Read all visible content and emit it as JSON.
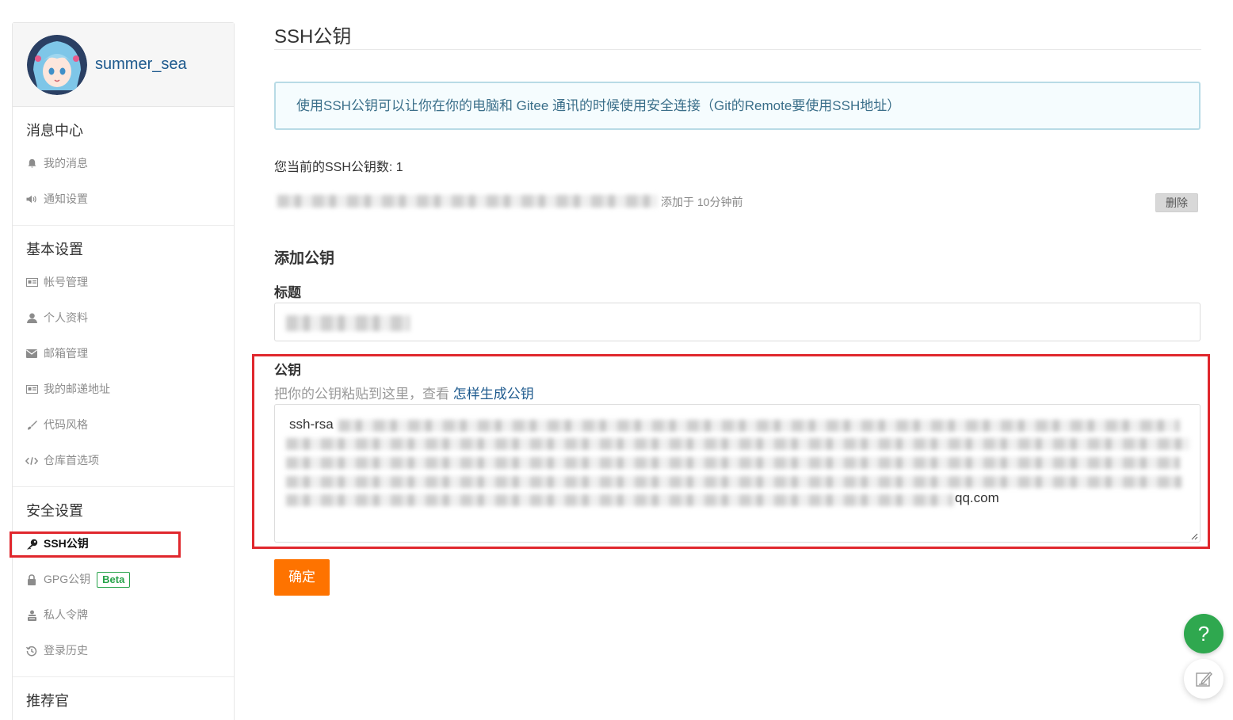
{
  "user": {
    "name": "summer_sea"
  },
  "sidebar": {
    "groups": [
      {
        "title": "消息中心",
        "items": [
          {
            "label": "我的消息",
            "icon": "bell-icon"
          },
          {
            "label": "通知设置",
            "icon": "speaker-icon"
          }
        ]
      },
      {
        "title": "基本设置",
        "items": [
          {
            "label": "帐号管理",
            "icon": "id-card-icon"
          },
          {
            "label": "个人资料",
            "icon": "user-icon"
          },
          {
            "label": "邮箱管理",
            "icon": "envelope-icon"
          },
          {
            "label": "我的邮递地址",
            "icon": "address-card-icon"
          },
          {
            "label": "代码风格",
            "icon": "brush-icon"
          },
          {
            "label": "仓库首选项",
            "icon": "code-icon"
          }
        ]
      },
      {
        "title": "安全设置",
        "items": [
          {
            "label": "SSH公钥",
            "icon": "key-icon",
            "active": true
          },
          {
            "label": "GPG公钥",
            "icon": "lock-icon",
            "badge": "Beta"
          },
          {
            "label": "私人令牌",
            "icon": "token-icon"
          },
          {
            "label": "登录历史",
            "icon": "history-icon"
          }
        ]
      },
      {
        "title": "推荐官",
        "items": []
      }
    ]
  },
  "main": {
    "title": "SSH公钥",
    "info": "使用SSH公钥可以让你在你的电脑和 Gitee 通讯的时候使用安全连接（Git的Remote要使用SSH地址）",
    "key_count": "您当前的SSH公钥数: 1",
    "key_added": "添加于 10分钟前",
    "delete_label": "删除",
    "add_heading": "添加公钥",
    "title_label": "标题",
    "pubkey_label": "公钥",
    "hint_prefix": "把你的公钥粘贴到这里，查看 ",
    "hint_link": "怎样生成公钥",
    "pubkey_prefix": "ssh-rsa ",
    "pubkey_suffix": "qq.com",
    "submit_label": "确定"
  },
  "floating": {
    "help": "?"
  },
  "colors": {
    "accent": "#fe7300",
    "link": "#1e5a8e",
    "highlight": "#e0272d",
    "help": "#2fa84f"
  }
}
